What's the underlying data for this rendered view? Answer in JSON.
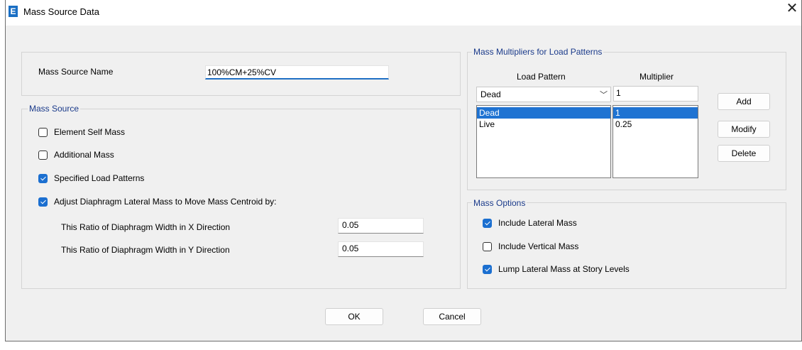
{
  "window": {
    "title": "Mass Source Data",
    "app_icon": "E"
  },
  "mass_source_name": {
    "label": "Mass Source Name",
    "value": "100%CM+25%CV"
  },
  "mass_source": {
    "legend": "Mass Source",
    "element_self_mass": {
      "label": "Element Self Mass",
      "checked": false
    },
    "additional_mass": {
      "label": "Additional Mass",
      "checked": false
    },
    "specified_load_patterns": {
      "label": "Specified Load Patterns",
      "checked": true
    },
    "adjust_diaphragm": {
      "label": "Adjust Diaphragm Lateral Mass to Move Mass Centroid by:",
      "checked": true
    },
    "ratio_x": {
      "label": "This Ratio of Diaphragm Width in X Direction",
      "value": "0.05"
    },
    "ratio_y": {
      "label": "This Ratio of Diaphragm Width in Y Direction",
      "value": "0.05"
    }
  },
  "multipliers": {
    "legend": "Mass Multipliers for Load Patterns",
    "col_load_pattern": "Load Pattern",
    "col_multiplier": "Multiplier",
    "selected_pattern": "Dead",
    "multiplier_value": "1",
    "patterns": [
      "Dead",
      "Live"
    ],
    "values": [
      "1",
      "0.25"
    ],
    "add_label": "Add",
    "modify_label": "Modify",
    "delete_label": "Delete"
  },
  "mass_options": {
    "legend": "Mass Options",
    "include_lateral": {
      "label": "Include Lateral Mass",
      "checked": true
    },
    "include_vertical": {
      "label": "Include Vertical Mass",
      "checked": false
    },
    "lump_lateral": {
      "label": "Lump Lateral Mass at Story Levels",
      "checked": true
    }
  },
  "buttons": {
    "ok": "OK",
    "cancel": "Cancel"
  },
  "colors": {
    "accent": "#1b6fd0",
    "legend_text": "#1a3a8a",
    "selection": "#1f73d2"
  }
}
